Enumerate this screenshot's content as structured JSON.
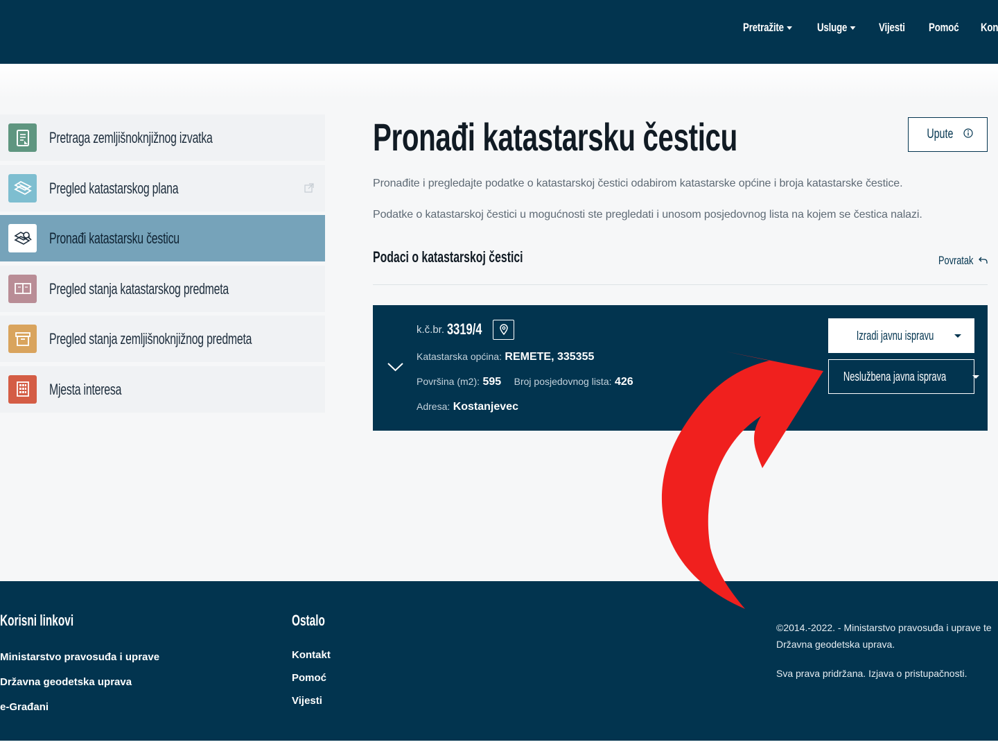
{
  "nav": {
    "items": [
      {
        "label": "Pretražite",
        "dropdown": true
      },
      {
        "label": "Usluge",
        "dropdown": true
      },
      {
        "label": "Vijesti",
        "dropdown": false
      },
      {
        "label": "Pomoć",
        "dropdown": false
      },
      {
        "label": "Kont",
        "dropdown": false
      }
    ]
  },
  "sidebar": {
    "items": [
      {
        "label": "Pretraga zemljišnoknjižnog izvatka",
        "icon": "document-icon",
        "color": "#5f9680"
      },
      {
        "label": "Pregled katastarskog plana",
        "icon": "map-icon",
        "color": "#7ebed0",
        "external": true
      },
      {
        "label": "Pronađi katastarsku česticu",
        "icon": "parcel-search-icon",
        "color": "#ffffff",
        "active": true
      },
      {
        "label": "Pregled stanja katastarskog predmeta",
        "icon": "book-icon",
        "color": "#b98d96"
      },
      {
        "label": "Pregled stanja zemljišnoknjižnog predmeta",
        "icon": "archive-icon",
        "color": "#d9a45d"
      },
      {
        "label": "Mjesta interesa",
        "icon": "building-icon",
        "color": "#d45d45"
      }
    ]
  },
  "main": {
    "title": "Pronađi katastarsku česticu",
    "upute_label": "Upute",
    "description_1": "Pronađite i pregledajte podatke o katastarskoj čestici odabirom katastarske općine i broja katastarske čestice.",
    "description_2": "Podatke o katastarskoj čestici u mogućnosti ste pregledati i unosom posjedovnog lista na kojem se čestica nalazi.",
    "section_title": "Podaci o katastarskoj čestici",
    "povratak_label": "Povratak"
  },
  "parcel": {
    "kc_label": "k.č.br.",
    "kc_value": "3319/4",
    "opcina_label": "Katastarska općina:",
    "opcina_value": "REMETE, 335355",
    "povrsina_label": "Površina (m2):",
    "povrsina_value": "595",
    "posjedovni_label": "Broj posjedovnog lista:",
    "posjedovni_value": "426",
    "adresa_label": "Adresa:",
    "adresa_value": "Kostanjevec",
    "btn_javna": "Izradi javnu ispravu",
    "btn_nesluzbena": "Neslužbena javna isprava"
  },
  "footer": {
    "col1_title": "Korisni linkovi",
    "col1_links": [
      "Ministarstvo pravosuđa i uprave",
      "Državna geodetska uprava",
      "e-Građani"
    ],
    "col2_title": "Ostalo",
    "col2_links": [
      "Kontakt",
      "Pomoć",
      "Vijesti"
    ],
    "copyright_1": "©2014.-2022. - Ministarstvo pravosuđa i uprave te",
    "copyright_2": "Državna geodetska uprava.",
    "rights": "Sva prava pridržana. Izjava o pristupačnosti."
  },
  "colors": {
    "navy": "#02344f",
    "active_item": "#76a3ba",
    "annotation_arrow": "#f0201e"
  }
}
